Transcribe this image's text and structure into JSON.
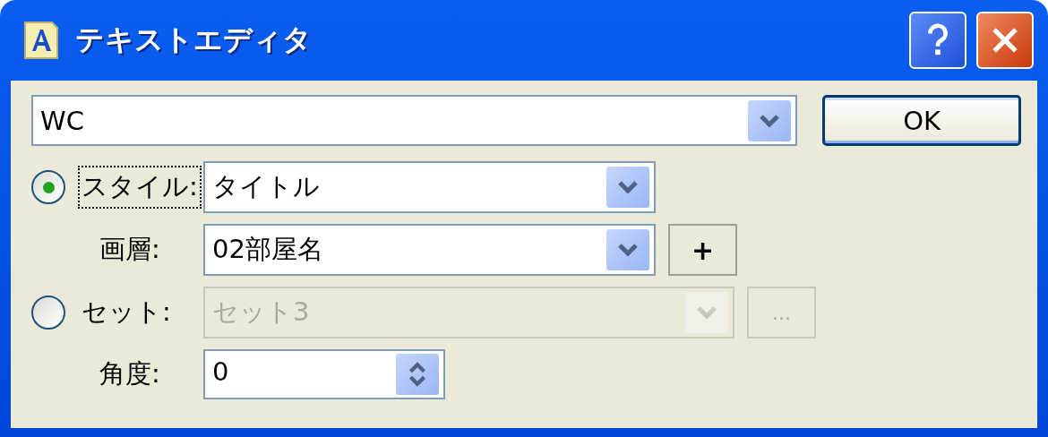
{
  "window": {
    "title": "テキストエディタ"
  },
  "text_field": {
    "value": "WC"
  },
  "ok_button": {
    "label": "OK"
  },
  "rows": [
    {
      "kind": "radio",
      "label": "スタイル:",
      "selected": true,
      "focused": true,
      "field": {
        "kind": "combo",
        "value": "タイトル",
        "disabled": false
      }
    },
    {
      "kind": "label",
      "label": "画層:",
      "field": {
        "kind": "combo",
        "value": "02部屋名",
        "disabled": false
      },
      "button": {
        "label": "+",
        "disabled": false
      }
    },
    {
      "kind": "radio",
      "label": "セット:",
      "selected": false,
      "focused": false,
      "field": {
        "kind": "combo",
        "value": "セット3",
        "disabled": true
      },
      "button": {
        "label": "...",
        "disabled": true
      }
    },
    {
      "kind": "label",
      "label": "角度:",
      "field": {
        "kind": "spinner",
        "value": "0",
        "disabled": false
      }
    }
  ]
}
